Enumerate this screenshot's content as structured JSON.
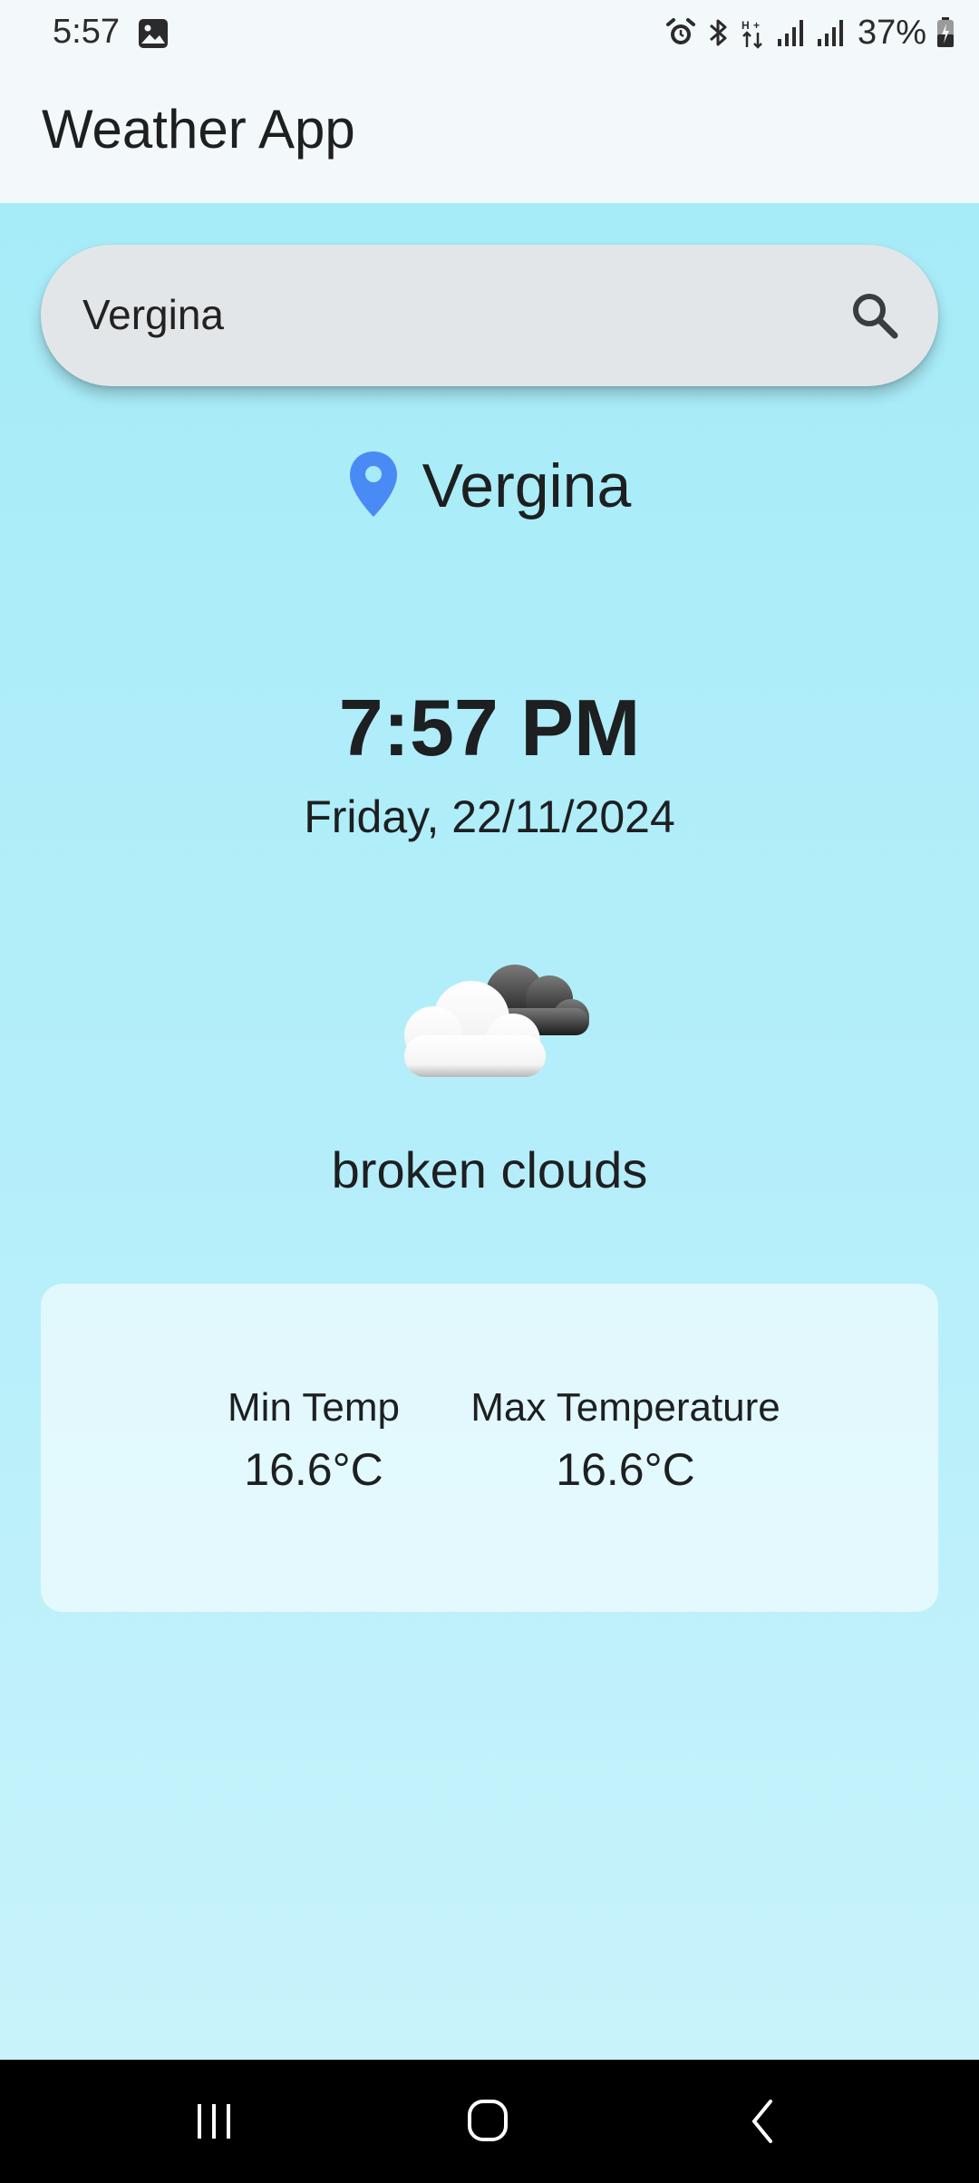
{
  "status_bar": {
    "time": "5:57",
    "battery": "37%",
    "icons": [
      "gallery-icon",
      "alarm-icon",
      "bluetooth-icon",
      "data-arrows-icon",
      "signal-icon",
      "signal-icon",
      "battery-charging-icon"
    ]
  },
  "app_bar": {
    "title": "Weather App"
  },
  "search": {
    "value": "Vergina",
    "icon": "search-icon"
  },
  "location": {
    "name": "Vergina",
    "icon": "location-pin-icon",
    "pin_color": "#4a8af4"
  },
  "clock": {
    "time": "7:57 PM",
    "date": "Friday, 22/11/2024"
  },
  "weather": {
    "icon": "broken-clouds-icon",
    "condition": "broken clouds"
  },
  "temperatures": {
    "min_label": "Min Temp",
    "min_value": "16.6°C",
    "max_label": "Max Temperature",
    "max_value": "16.6°C"
  },
  "nav": {
    "icons": [
      "recent-apps-icon",
      "home-icon",
      "back-icon"
    ]
  },
  "colors": {
    "background_top": "#a6ecf8",
    "background_bottom": "#c8f3fb",
    "search_bar": "#e3e6e8",
    "app_bar": "#f3f8fa"
  }
}
